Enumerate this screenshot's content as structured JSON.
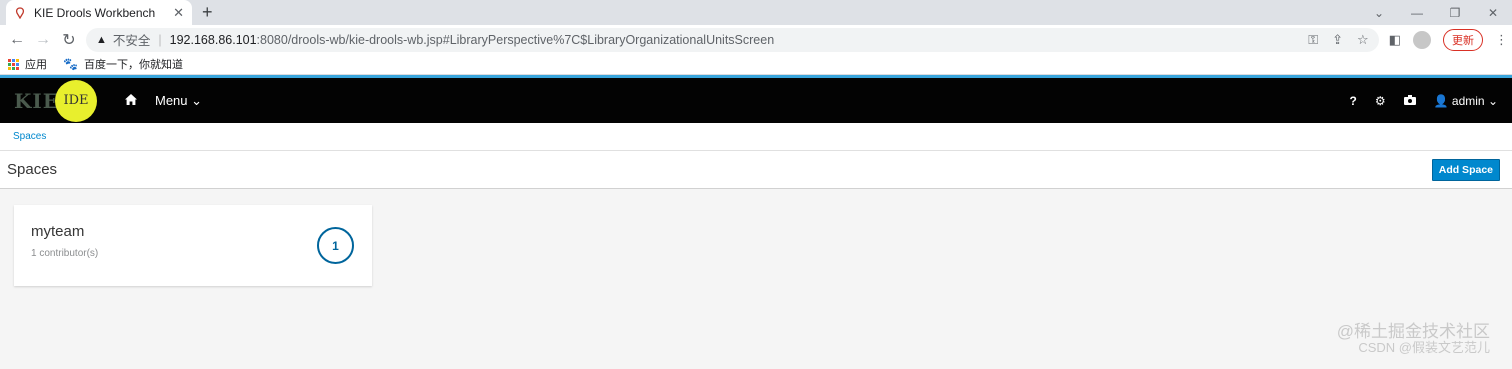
{
  "browser": {
    "tab_title": "KIE Drools Workbench",
    "new_tab": "+",
    "insecure_label": "不安全",
    "url_host": "192.168.86.101",
    "url_path": ":8080/drools-wb/kie-drools-wb.jsp#LibraryPerspective%7C$LibraryOrganizationalUnitsScreen",
    "update_label": "更新",
    "bookmarks": [
      {
        "label": "应用",
        "icon": "apps-icon"
      },
      {
        "label": "百度一下，你就知道",
        "icon": "baidu-icon"
      }
    ]
  },
  "app": {
    "brand_kie": "KIE",
    "brand_ide": "IDE",
    "menu_label": "Menu",
    "help_label": "?",
    "user_label": "admin",
    "accent_color": "#0088ce",
    "navbar_color": "#030303"
  },
  "breadcrumb": "Spaces",
  "page_title": "Spaces",
  "add_space_label": "Add Space",
  "spaces": [
    {
      "name": "myteam",
      "contributors": "1 contributor(s)",
      "count": "1"
    }
  ],
  "watermark": {
    "line1": "@稀土掘金技术社区",
    "line2": "CSDN @假装文艺范儿"
  }
}
